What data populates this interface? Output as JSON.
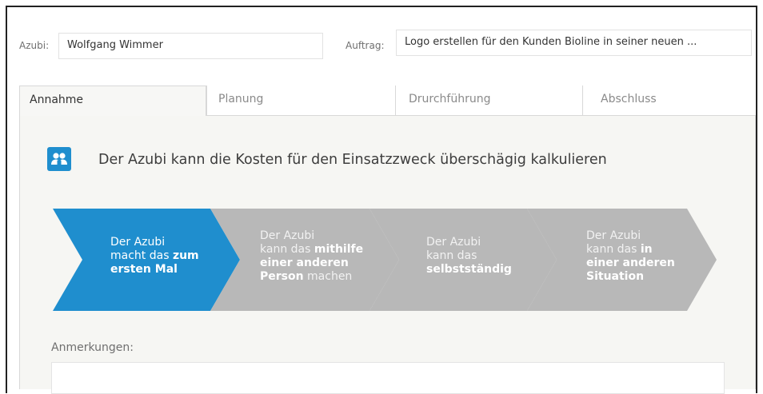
{
  "header": {
    "azubi_label": "Azubi:",
    "azubi_value": "Wolfgang Wimmer",
    "auftrag_label": "Auftrag:",
    "auftrag_value": "Logo erstellen für den Kunden Bioline in seiner neuen ..."
  },
  "tabs": [
    {
      "label": "Annahme",
      "active": true
    },
    {
      "label": "Planung",
      "active": false
    },
    {
      "label": "Drurchführung",
      "active": false
    },
    {
      "label": "Abschluss",
      "active": false
    }
  ],
  "competence": {
    "icon": "users-icon",
    "title": "Der Azubi kann die Kosten für den Einsatzzweck überschägig kalkulieren"
  },
  "steps": [
    {
      "line1": "Der Azubi",
      "line2a": "macht das ",
      "line2b": "zum",
      "line3": "ersten Mal",
      "line4a": "",
      "line4b": "",
      "color": "#1f8ece",
      "selected": true
    },
    {
      "line1": "Der Azubi",
      "line2a": "kann das ",
      "line2b": "mithilfe",
      "line3": "einer anderen",
      "line4a": "Person",
      "line4b": " machen",
      "color": "#b8b8b8",
      "selected": false
    },
    {
      "line1": "Der Azubi",
      "line2a": "kann das",
      "line2b": "",
      "line3": "selbstständig",
      "line4a": "",
      "line4b": "",
      "color": "#b8b8b8",
      "selected": false
    },
    {
      "line1": "Der Azubi",
      "line2a": "kann das ",
      "line2b": "in",
      "line3": "einer anderen",
      "line4a": "Situation",
      "line4b": "",
      "color": "#b8b8b8",
      "selected": false
    }
  ],
  "notes": {
    "label": "Anmerkungen:",
    "value": ""
  }
}
